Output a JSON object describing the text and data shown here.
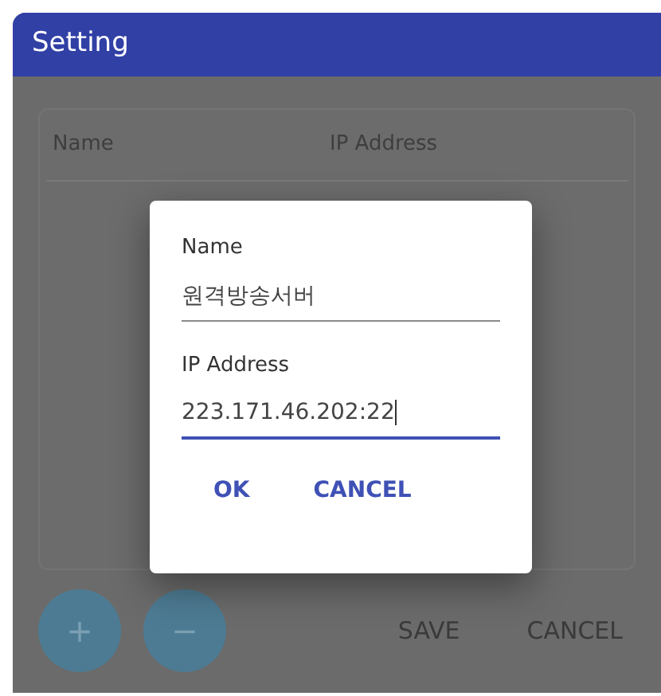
{
  "window": {
    "title": "Setting"
  },
  "table": {
    "columns": [
      "Name",
      "IP Address"
    ]
  },
  "toolbar": {
    "icon_buttons": [
      "+",
      "−"
    ],
    "buttons": [
      "SAVE",
      "CANCEL"
    ]
  },
  "dialog": {
    "fields": [
      {
        "label": "Name",
        "value": "원격방송서버",
        "focused": false
      },
      {
        "label": "IP Address",
        "value": "223.171.46.202:22",
        "focused": true
      }
    ],
    "buttons": [
      "OK",
      "CANCEL"
    ]
  }
}
